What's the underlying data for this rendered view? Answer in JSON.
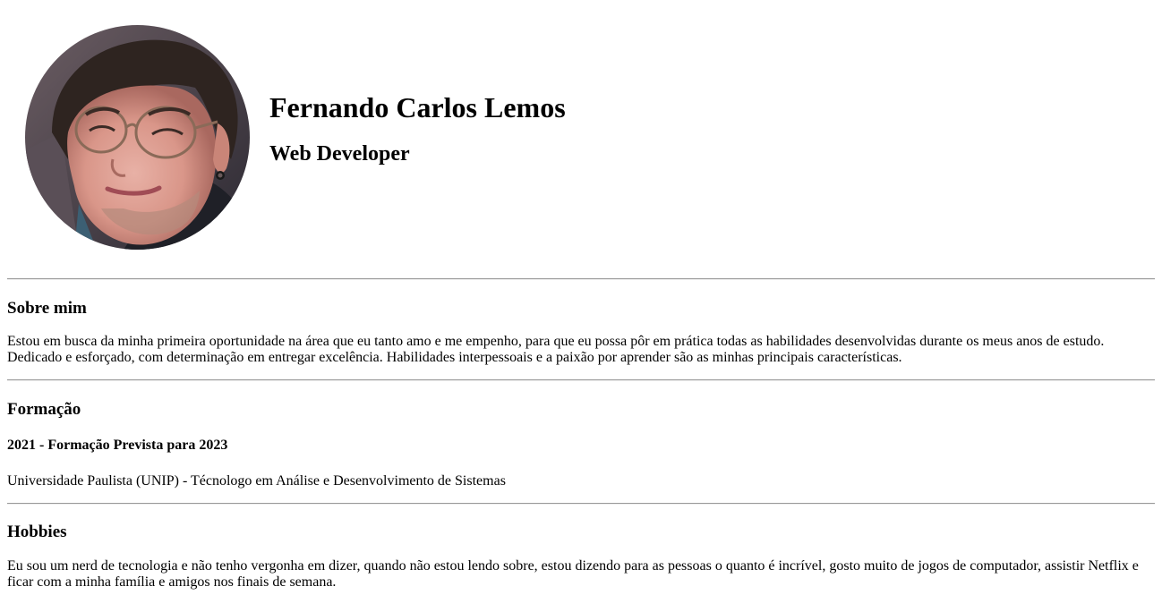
{
  "profile": {
    "name": "Fernando Carlos Lemos",
    "role": "Web Developer",
    "photo": "profile-photo"
  },
  "about": {
    "title": "Sobre mim",
    "text": "Estou em busca da minha primeira oportunidade na área que eu tanto amo e me empenho, para que eu possa pôr em prática todas as habilidades desenvolvidas durante os meus anos de estudo. Dedicado e esforçado, com determinação em entregar excelência. Habilidades interpessoais e a paixão por aprender são as minhas principais características."
  },
  "education": {
    "title": "Formação",
    "period": "2021 - Formação Prevista para 2023",
    "course": "Universidade Paulista (UNIP) - Técnologo em Análise e Desenvolvimento de Sistemas"
  },
  "hobbies": {
    "title": "Hobbies",
    "text": "Eu sou um nerd de tecnologia e não tenho vergonha em dizer, quando não estou lendo sobre, estou dizendo para as pessoas o quanto é incrível, gosto muito de jogos de computador, assistir Netflix e ficar com a minha família e amigos nos finais de semana."
  },
  "colors": {
    "text": "#000000",
    "background": "#ffffff",
    "divider": "#9a9a9a"
  }
}
